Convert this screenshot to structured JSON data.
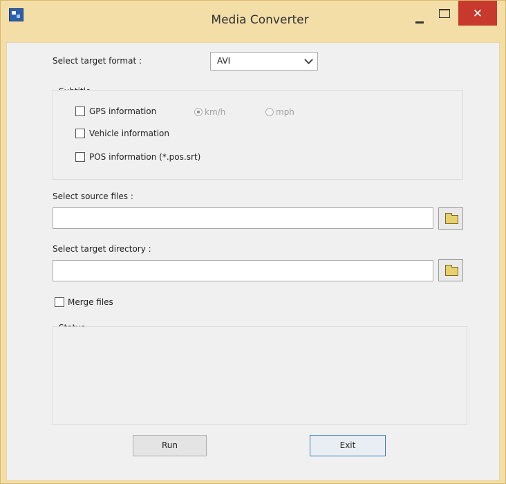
{
  "window": {
    "title": "Media Converter"
  },
  "format": {
    "label": "Select target format :",
    "selected": "AVI"
  },
  "subtitle": {
    "group_label": "Subtitle",
    "gps_label": "GPS information",
    "unit_kmh": "km/h",
    "unit_mph": "mph",
    "vehicle_label": "Vehicle information",
    "pos_label": "POS information (*.pos.srt)"
  },
  "source": {
    "label": "Select source files :",
    "value": ""
  },
  "target": {
    "label": "Select target directory :",
    "value": ""
  },
  "merge": {
    "label": "Merge files"
  },
  "status": {
    "label": "Status",
    "text": ""
  },
  "buttons": {
    "run": "Run",
    "exit": "Exit"
  },
  "icons": {
    "app": "app-icon",
    "browse": "folder-icon"
  }
}
